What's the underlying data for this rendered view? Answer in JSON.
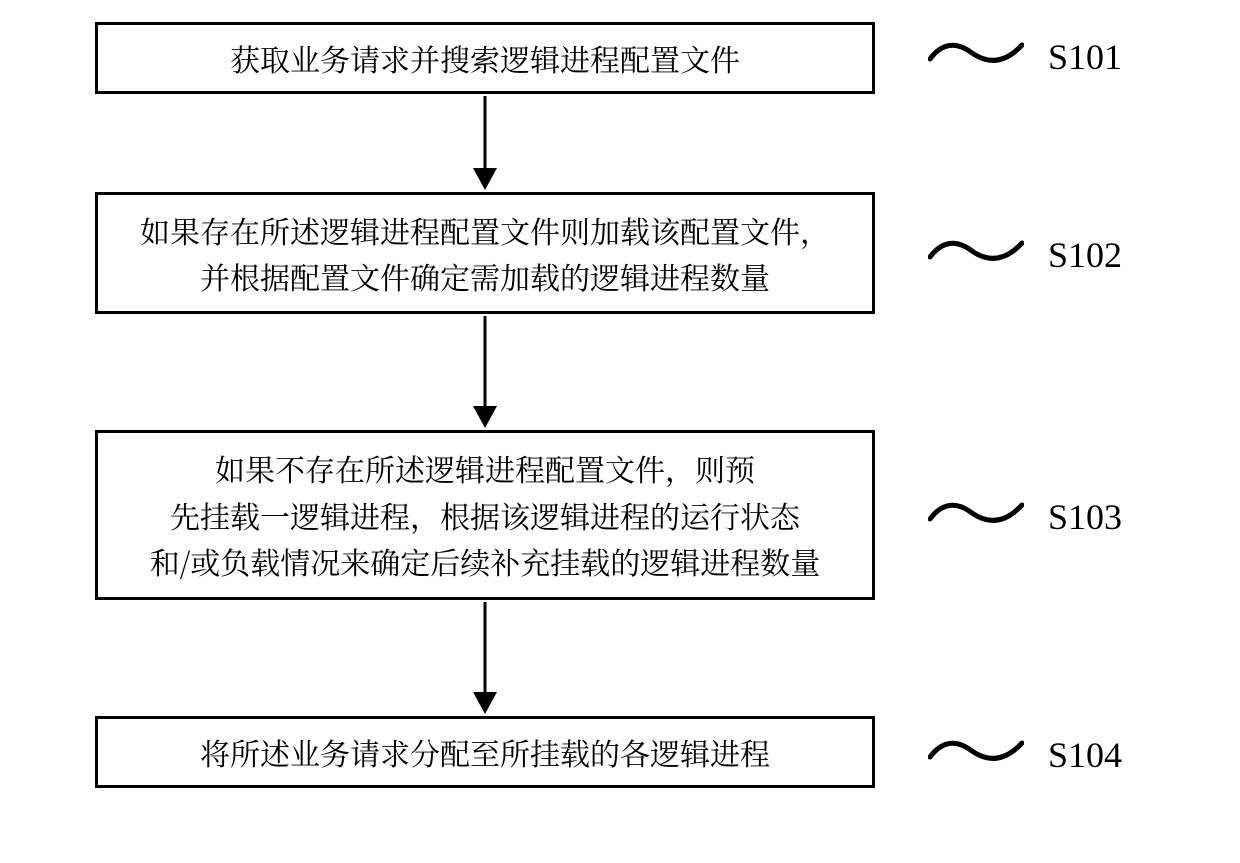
{
  "flowchart": {
    "steps": [
      {
        "id": "S101",
        "text": "获取业务请求并搜索逻辑进程配置文件",
        "label": "S101"
      },
      {
        "id": "S102",
        "text": "如果存在所述逻辑进程配置文件则加载该配置文件，\n并根据配置文件确定需加载的逻辑进程数量",
        "label": "S102"
      },
      {
        "id": "S103",
        "text": "如果不存在所述逻辑进程配置文件，则预\n先挂载一逻辑进程，根据该逻辑进程的运行状态\n和/或负载情况来确定后续补充挂载的逻辑进程数量",
        "label": "S103"
      },
      {
        "id": "S104",
        "text": "将所述业务请求分配至所挂载的各逻辑进程",
        "label": "S104"
      }
    ]
  }
}
